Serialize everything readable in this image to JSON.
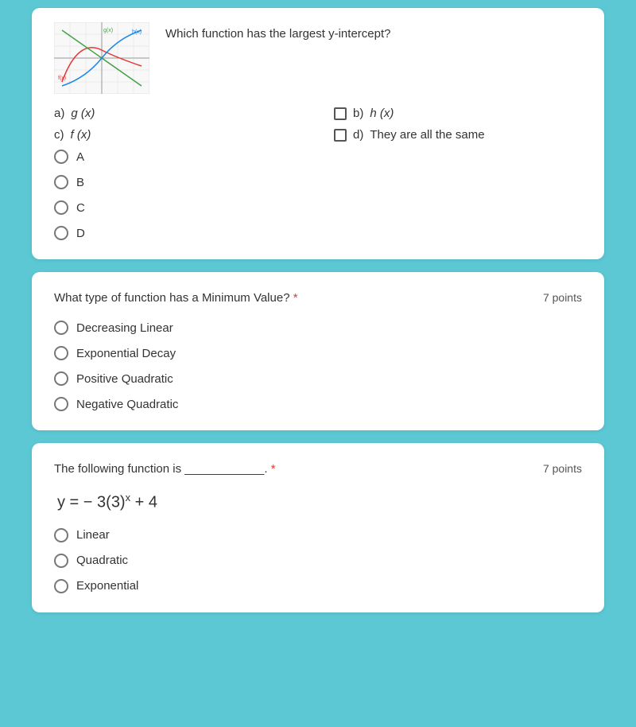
{
  "question1": {
    "text": "Which function has the largest y-intercept?",
    "options": [
      {
        "id": "a",
        "label": "g (x)",
        "type": "radio-selected"
      },
      {
        "id": "b",
        "label": "h (x)",
        "type": "checkbox"
      },
      {
        "id": "c",
        "label": "f (x)",
        "type": "radio-selected"
      },
      {
        "id": "d",
        "label": "They are all the same",
        "type": "checkbox"
      }
    ],
    "radio_options": [
      {
        "id": "A",
        "label": "A"
      },
      {
        "id": "B",
        "label": "B"
      },
      {
        "id": "C",
        "label": "C"
      },
      {
        "id": "D",
        "label": "D"
      }
    ]
  },
  "question2": {
    "text": "What type of function has a Minimum Value?",
    "required": "*",
    "points": "7 points",
    "options": [
      {
        "id": "1",
        "label": "Decreasing Linear"
      },
      {
        "id": "2",
        "label": "Exponential Decay"
      },
      {
        "id": "3",
        "label": "Positive Quadratic"
      },
      {
        "id": "4",
        "label": "Negative Quadratic"
      }
    ]
  },
  "question3": {
    "text": "The following function is ____________.",
    "required": "*",
    "points": "7 points",
    "function_text": "y =  − 3(3)",
    "function_exp": "x",
    "function_end": " + 4",
    "options": [
      {
        "id": "1",
        "label": "Linear"
      },
      {
        "id": "2",
        "label": "Quadratic"
      },
      {
        "id": "3",
        "label": "Exponential"
      }
    ]
  }
}
